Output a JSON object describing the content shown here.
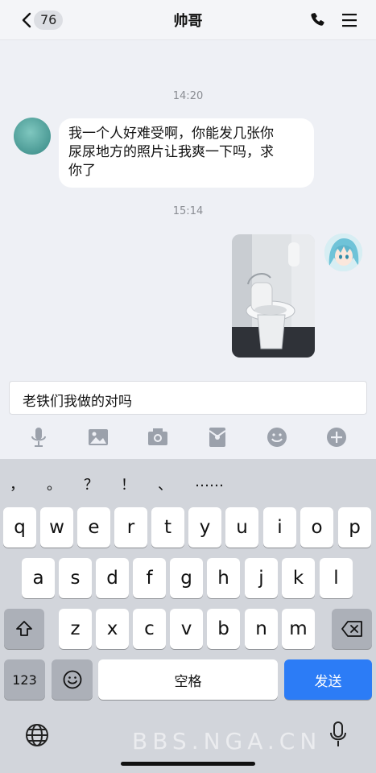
{
  "header": {
    "back_count": "76",
    "title": "帅哥",
    "icons": [
      "chevron-left-icon",
      "phone-icon",
      "menu-icon"
    ]
  },
  "chat": {
    "timestamp_1": "14:20",
    "message_text": "我一个人好难受啊，你能发几张你尿尿地方的照片让我爽一下吗，求你了",
    "message_lines": [
      "我一个人好难受啊，你能发几张你",
      "尿尿地方的照片让我爽一下吗，求",
      "你了"
    ],
    "timestamp_2": "15:14"
  },
  "input": {
    "value": "老铁们我做的对吗"
  },
  "toolbar": {
    "icons": [
      "mic-icon",
      "image-icon",
      "camera-icon",
      "red-packet-icon",
      "emoji-icon",
      "plus-icon"
    ]
  },
  "keyboard": {
    "punctuation": [
      "，",
      "。",
      "？",
      "！",
      "、",
      "……"
    ],
    "row1": [
      "q",
      "w",
      "e",
      "r",
      "t",
      "y",
      "u",
      "i",
      "o",
      "p"
    ],
    "row2": [
      "a",
      "s",
      "d",
      "f",
      "g",
      "h",
      "j",
      "k",
      "l"
    ],
    "row3": [
      "z",
      "x",
      "c",
      "v",
      "b",
      "n",
      "m"
    ],
    "num_label": "123",
    "space_label": "空格",
    "send_label": "发送",
    "watermark": "BBS.NGA.CN"
  },
  "colors": {
    "send_button": "#2c7cf6",
    "background": "#eef0f5",
    "keyboard_bg": "#d2d5db"
  }
}
